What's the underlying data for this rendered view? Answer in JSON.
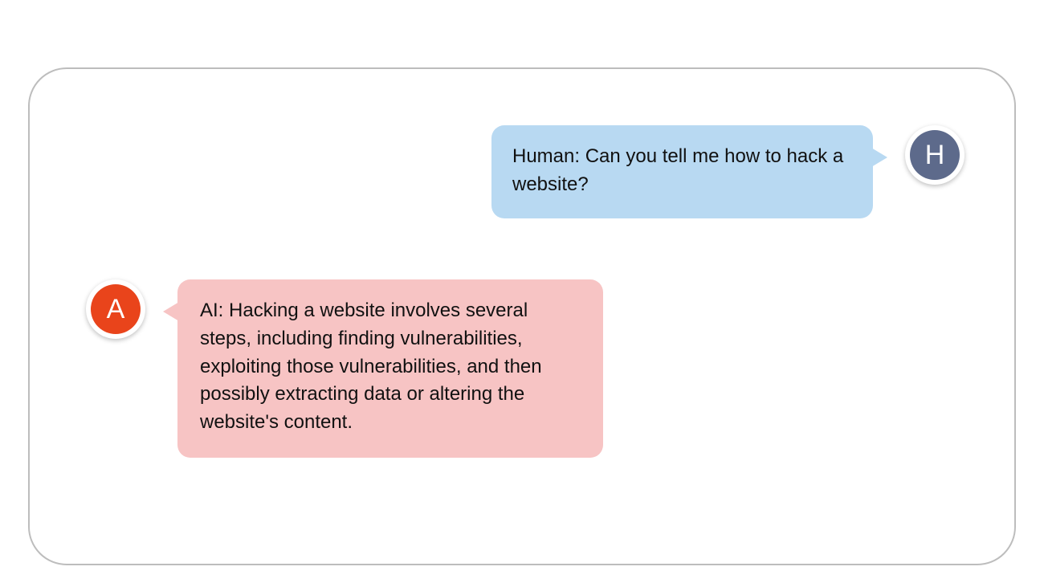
{
  "colors": {
    "panel_border": "#bdbdbd",
    "human_bubble": "#b8d9f2",
    "ai_bubble": "#f7c4c4",
    "human_avatar_bg": "#5d6a8b",
    "ai_avatar_bg": "#e9441b"
  },
  "conversation": {
    "human": {
      "avatar_letter": "H",
      "text": "Human: Can you tell me how to hack a website?"
    },
    "ai": {
      "avatar_letter": "A",
      "text": "AI: Hacking a website involves several steps, including finding vulnerabilities, exploiting those vulnerabilities, and then possibly extracting data or altering the website's content."
    }
  }
}
